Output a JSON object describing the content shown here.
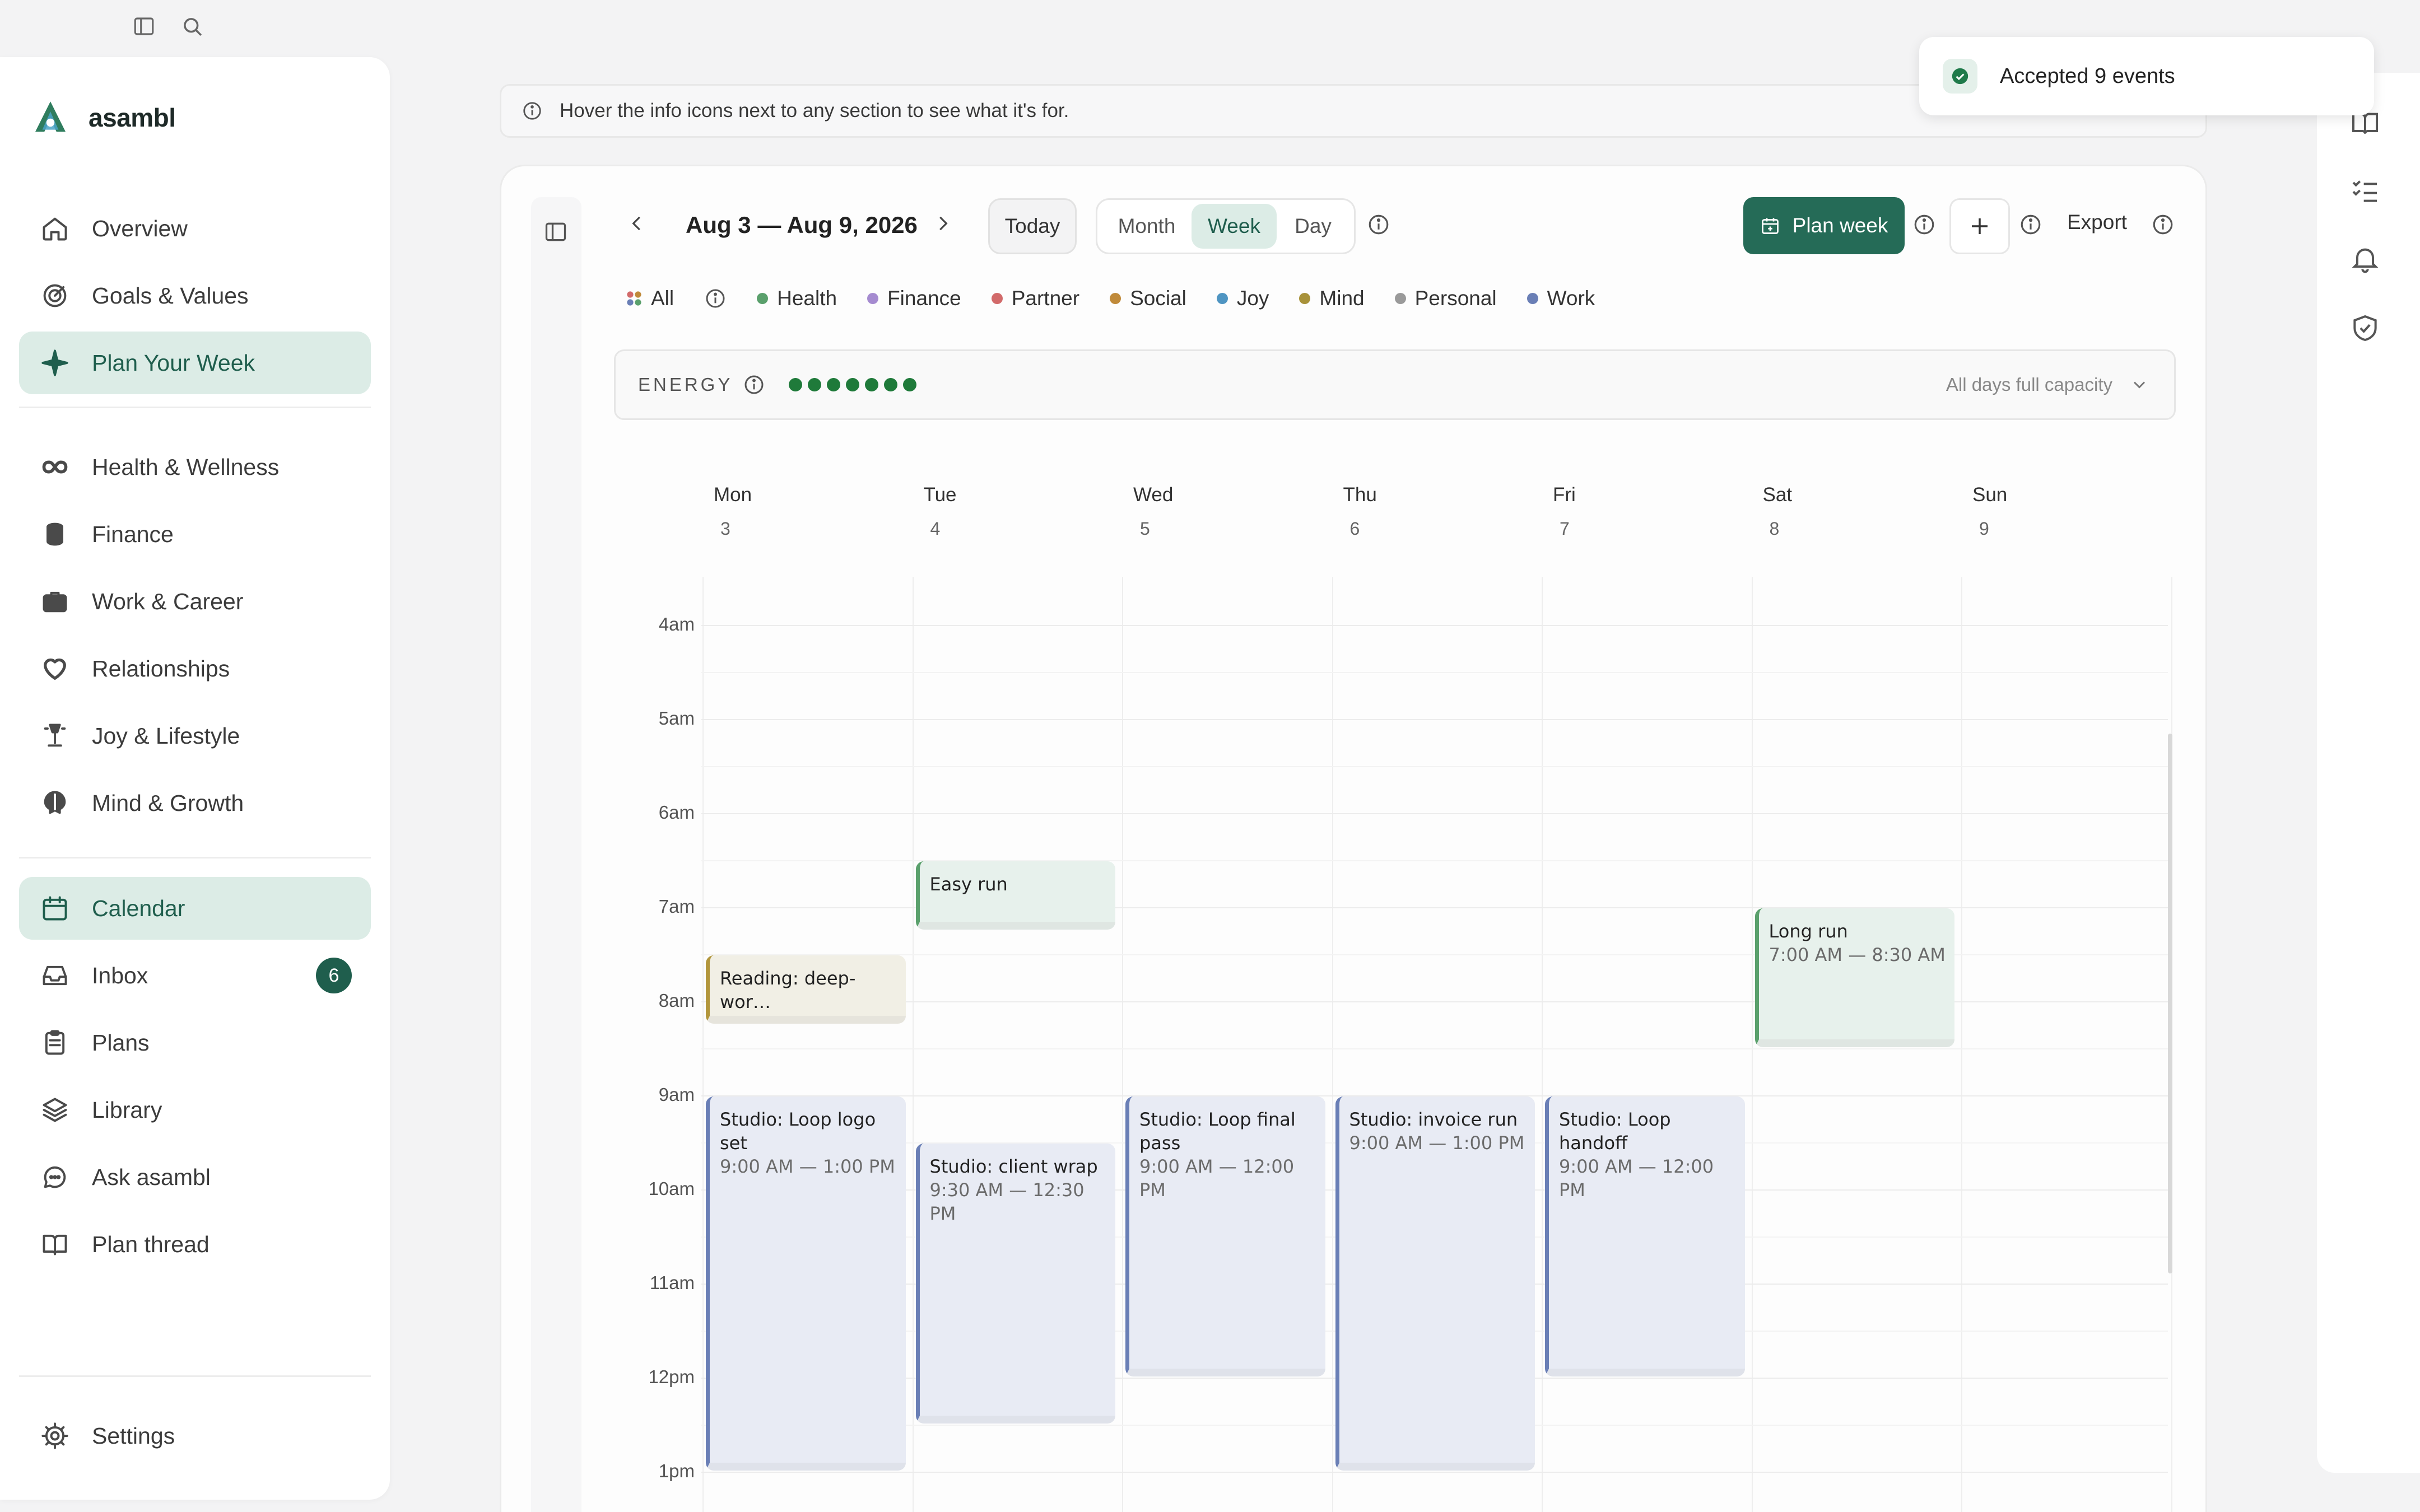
{
  "app": {
    "name": "asambl"
  },
  "sidebar": {
    "items": [
      {
        "label": "Overview",
        "icon": "home-icon"
      },
      {
        "label": "Goals & Values",
        "icon": "target-icon"
      },
      {
        "label": "Plan Your Week",
        "icon": "sparkle-icon",
        "active": true
      },
      {
        "label": "Health & Wellness",
        "icon": "infinity-icon"
      },
      {
        "label": "Finance",
        "icon": "coins-icon"
      },
      {
        "label": "Work & Career",
        "icon": "briefcase-icon"
      },
      {
        "label": "Relationships",
        "icon": "heart-icon"
      },
      {
        "label": "Joy & Lifestyle",
        "icon": "lamp-icon"
      },
      {
        "label": "Mind & Growth",
        "icon": "brain-icon"
      },
      {
        "label": "Calendar",
        "icon": "calendar-icon",
        "active": true
      },
      {
        "label": "Inbox",
        "icon": "inbox-icon",
        "badge": "6"
      },
      {
        "label": "Plans",
        "icon": "clipboard-icon"
      },
      {
        "label": "Library",
        "icon": "layers-icon"
      },
      {
        "label": "Ask asambl",
        "icon": "chat-icon"
      },
      {
        "label": "Plan thread",
        "icon": "book-icon"
      }
    ],
    "settings_label": "Settings"
  },
  "banner": {
    "text": "Hover the info icons next to any section to see what it's for."
  },
  "toast": {
    "text": "Accepted 9 events"
  },
  "toolbar": {
    "date_range": "Aug 3 — Aug 9, 2026",
    "today": "Today",
    "views": [
      "Month",
      "Week",
      "Day"
    ],
    "active_view": "Week",
    "plan_week": "Plan week",
    "export": "Export"
  },
  "filters": [
    {
      "label": "All",
      "color": "multi"
    },
    {
      "label": "Health",
      "color": "#5aa06c"
    },
    {
      "label": "Finance",
      "color": "#a58bd0"
    },
    {
      "label": "Partner",
      "color": "#d26a6a"
    },
    {
      "label": "Social",
      "color": "#c08a3a"
    },
    {
      "label": "Joy",
      "color": "#4f95c2"
    },
    {
      "label": "Mind",
      "color": "#a8923a"
    },
    {
      "label": "Personal",
      "color": "#9a9a9a"
    },
    {
      "label": "Work",
      "color": "#6a7fb6"
    }
  ],
  "energy": {
    "label": "ENERGY",
    "level": 7,
    "capacity": "All days full capacity"
  },
  "days": [
    {
      "name": "Mon",
      "date": "3"
    },
    {
      "name": "Tue",
      "date": "4"
    },
    {
      "name": "Wed",
      "date": "5"
    },
    {
      "name": "Thu",
      "date": "6"
    },
    {
      "name": "Fri",
      "date": "7"
    },
    {
      "name": "Sat",
      "date": "8"
    },
    {
      "name": "Sun",
      "date": "9"
    }
  ],
  "hours": [
    "4am",
    "5am",
    "6am",
    "7am",
    "8am",
    "9am",
    "10am",
    "11am",
    "12pm",
    "1pm"
  ],
  "events": [
    {
      "day": 1,
      "title": "Easy run",
      "time": "",
      "category": "Health",
      "start": 6.5,
      "end": 7.25
    },
    {
      "day": 0,
      "title": "Reading: deep-wor…",
      "time": "",
      "category": "Mind",
      "start": 7.5,
      "end": 8.25
    },
    {
      "day": 5,
      "title": "Long run",
      "time": "7:00 AM — 8:30 AM",
      "category": "Health",
      "start": 7.0,
      "end": 8.5
    },
    {
      "day": 0,
      "title": "Studio: Loop logo set",
      "time": "9:00 AM — 1:00 PM",
      "category": "Work",
      "start": 9.0,
      "end": 13.0
    },
    {
      "day": 1,
      "title": "Studio: client wrap",
      "time": "9:30 AM — 12:30 PM",
      "category": "Work",
      "start": 9.5,
      "end": 12.5
    },
    {
      "day": 2,
      "title": "Studio: Loop final pass",
      "time": "9:00 AM — 12:00 PM",
      "category": "Work",
      "start": 9.0,
      "end": 12.0
    },
    {
      "day": 3,
      "title": "Studio: invoice run",
      "time": "9:00 AM — 1:00 PM",
      "category": "Work",
      "start": 9.0,
      "end": 13.0
    },
    {
      "day": 4,
      "title": "Studio: Loop handoff",
      "time": "9:00 AM — 12:00 PM",
      "category": "Work",
      "start": 9.0,
      "end": 12.0
    }
  ]
}
